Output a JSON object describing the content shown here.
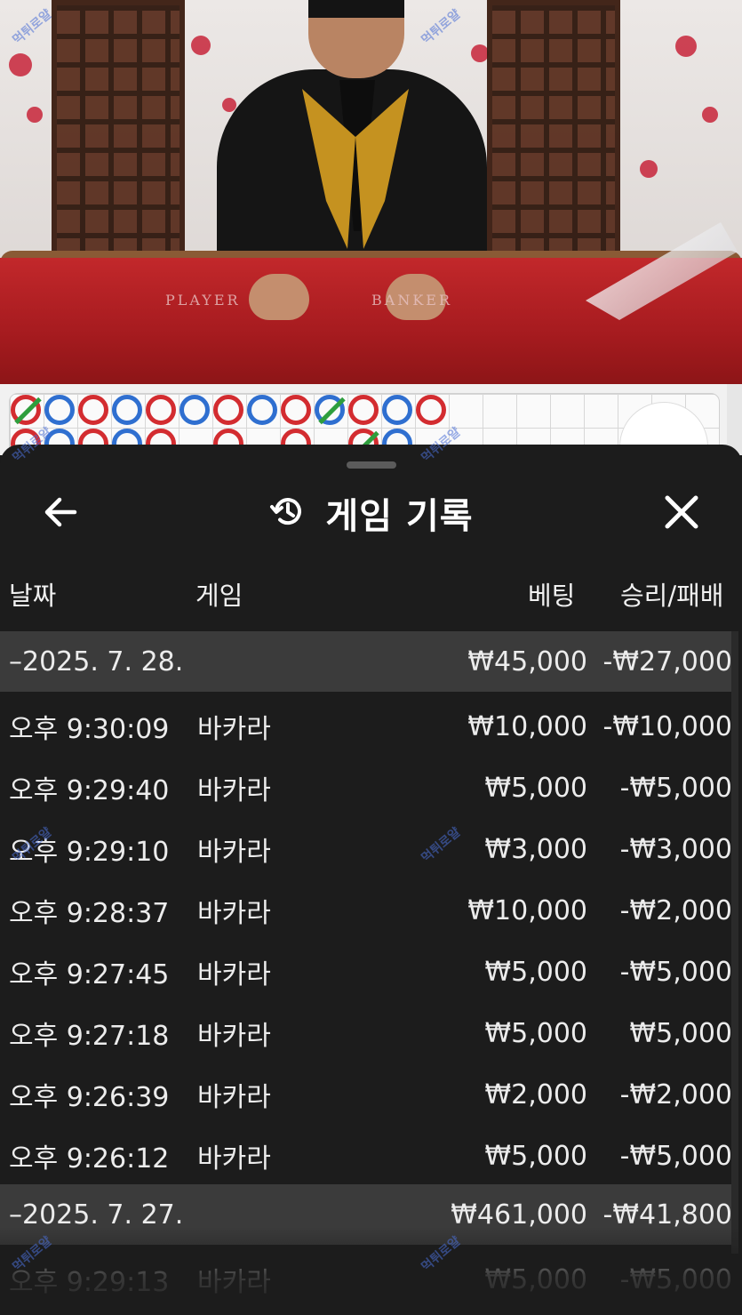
{
  "video": {
    "player_label": "PLAYER",
    "banker_label": "BANKER"
  },
  "roadmap": {
    "row1": [
      "tie-red",
      "blue",
      "red",
      "blue",
      "red",
      "blue",
      "red",
      "blue",
      "red",
      "tie-blue",
      "red",
      "blue",
      "red"
    ],
    "row2": [
      "red",
      "blue",
      "red",
      "blue",
      "red",
      "",
      "red",
      "",
      "red",
      "",
      "tie-red",
      "blue",
      ""
    ]
  },
  "sheet": {
    "title": "게임 기록",
    "back_icon": "arrow-left-icon",
    "history_icon": "history-icon",
    "close_icon": "close-icon",
    "columns": {
      "date": "날짜",
      "game": "게임",
      "bet": "베팅",
      "result": "승리/패배"
    },
    "groups": [
      {
        "date": "–2025. 7. 28.",
        "bet_total": "₩45,000",
        "result_total": "-₩27,000",
        "rows": [
          {
            "time": "오후 9:30:09",
            "game": "바카라",
            "bet": "₩10,000",
            "result": "-₩10,000"
          },
          {
            "time": "오후 9:29:40",
            "game": "바카라",
            "bet": "₩5,000",
            "result": "-₩5,000"
          },
          {
            "time": "오후 9:29:10",
            "game": "바카라",
            "bet": "₩3,000",
            "result": "-₩3,000"
          },
          {
            "time": "오후 9:28:37",
            "game": "바카라",
            "bet": "₩10,000",
            "result": "-₩2,000"
          },
          {
            "time": "오후 9:27:45",
            "game": "바카라",
            "bet": "₩5,000",
            "result": "-₩5,000"
          },
          {
            "time": "오후 9:27:18",
            "game": "바카라",
            "bet": "₩5,000",
            "result": "₩5,000"
          },
          {
            "time": "오후 9:26:39",
            "game": "바카라",
            "bet": "₩2,000",
            "result": "-₩2,000"
          },
          {
            "time": "오후 9:26:12",
            "game": "바카라",
            "bet": "₩5,000",
            "result": "-₩5,000"
          }
        ]
      },
      {
        "date": "–2025. 7. 27.",
        "bet_total": "₩461,000",
        "result_total": "-₩41,800",
        "rows": [
          {
            "time": "오후 9:29:13",
            "game": "바카라",
            "bet": "₩5,000",
            "result": "-₩5,000"
          }
        ]
      }
    ]
  }
}
